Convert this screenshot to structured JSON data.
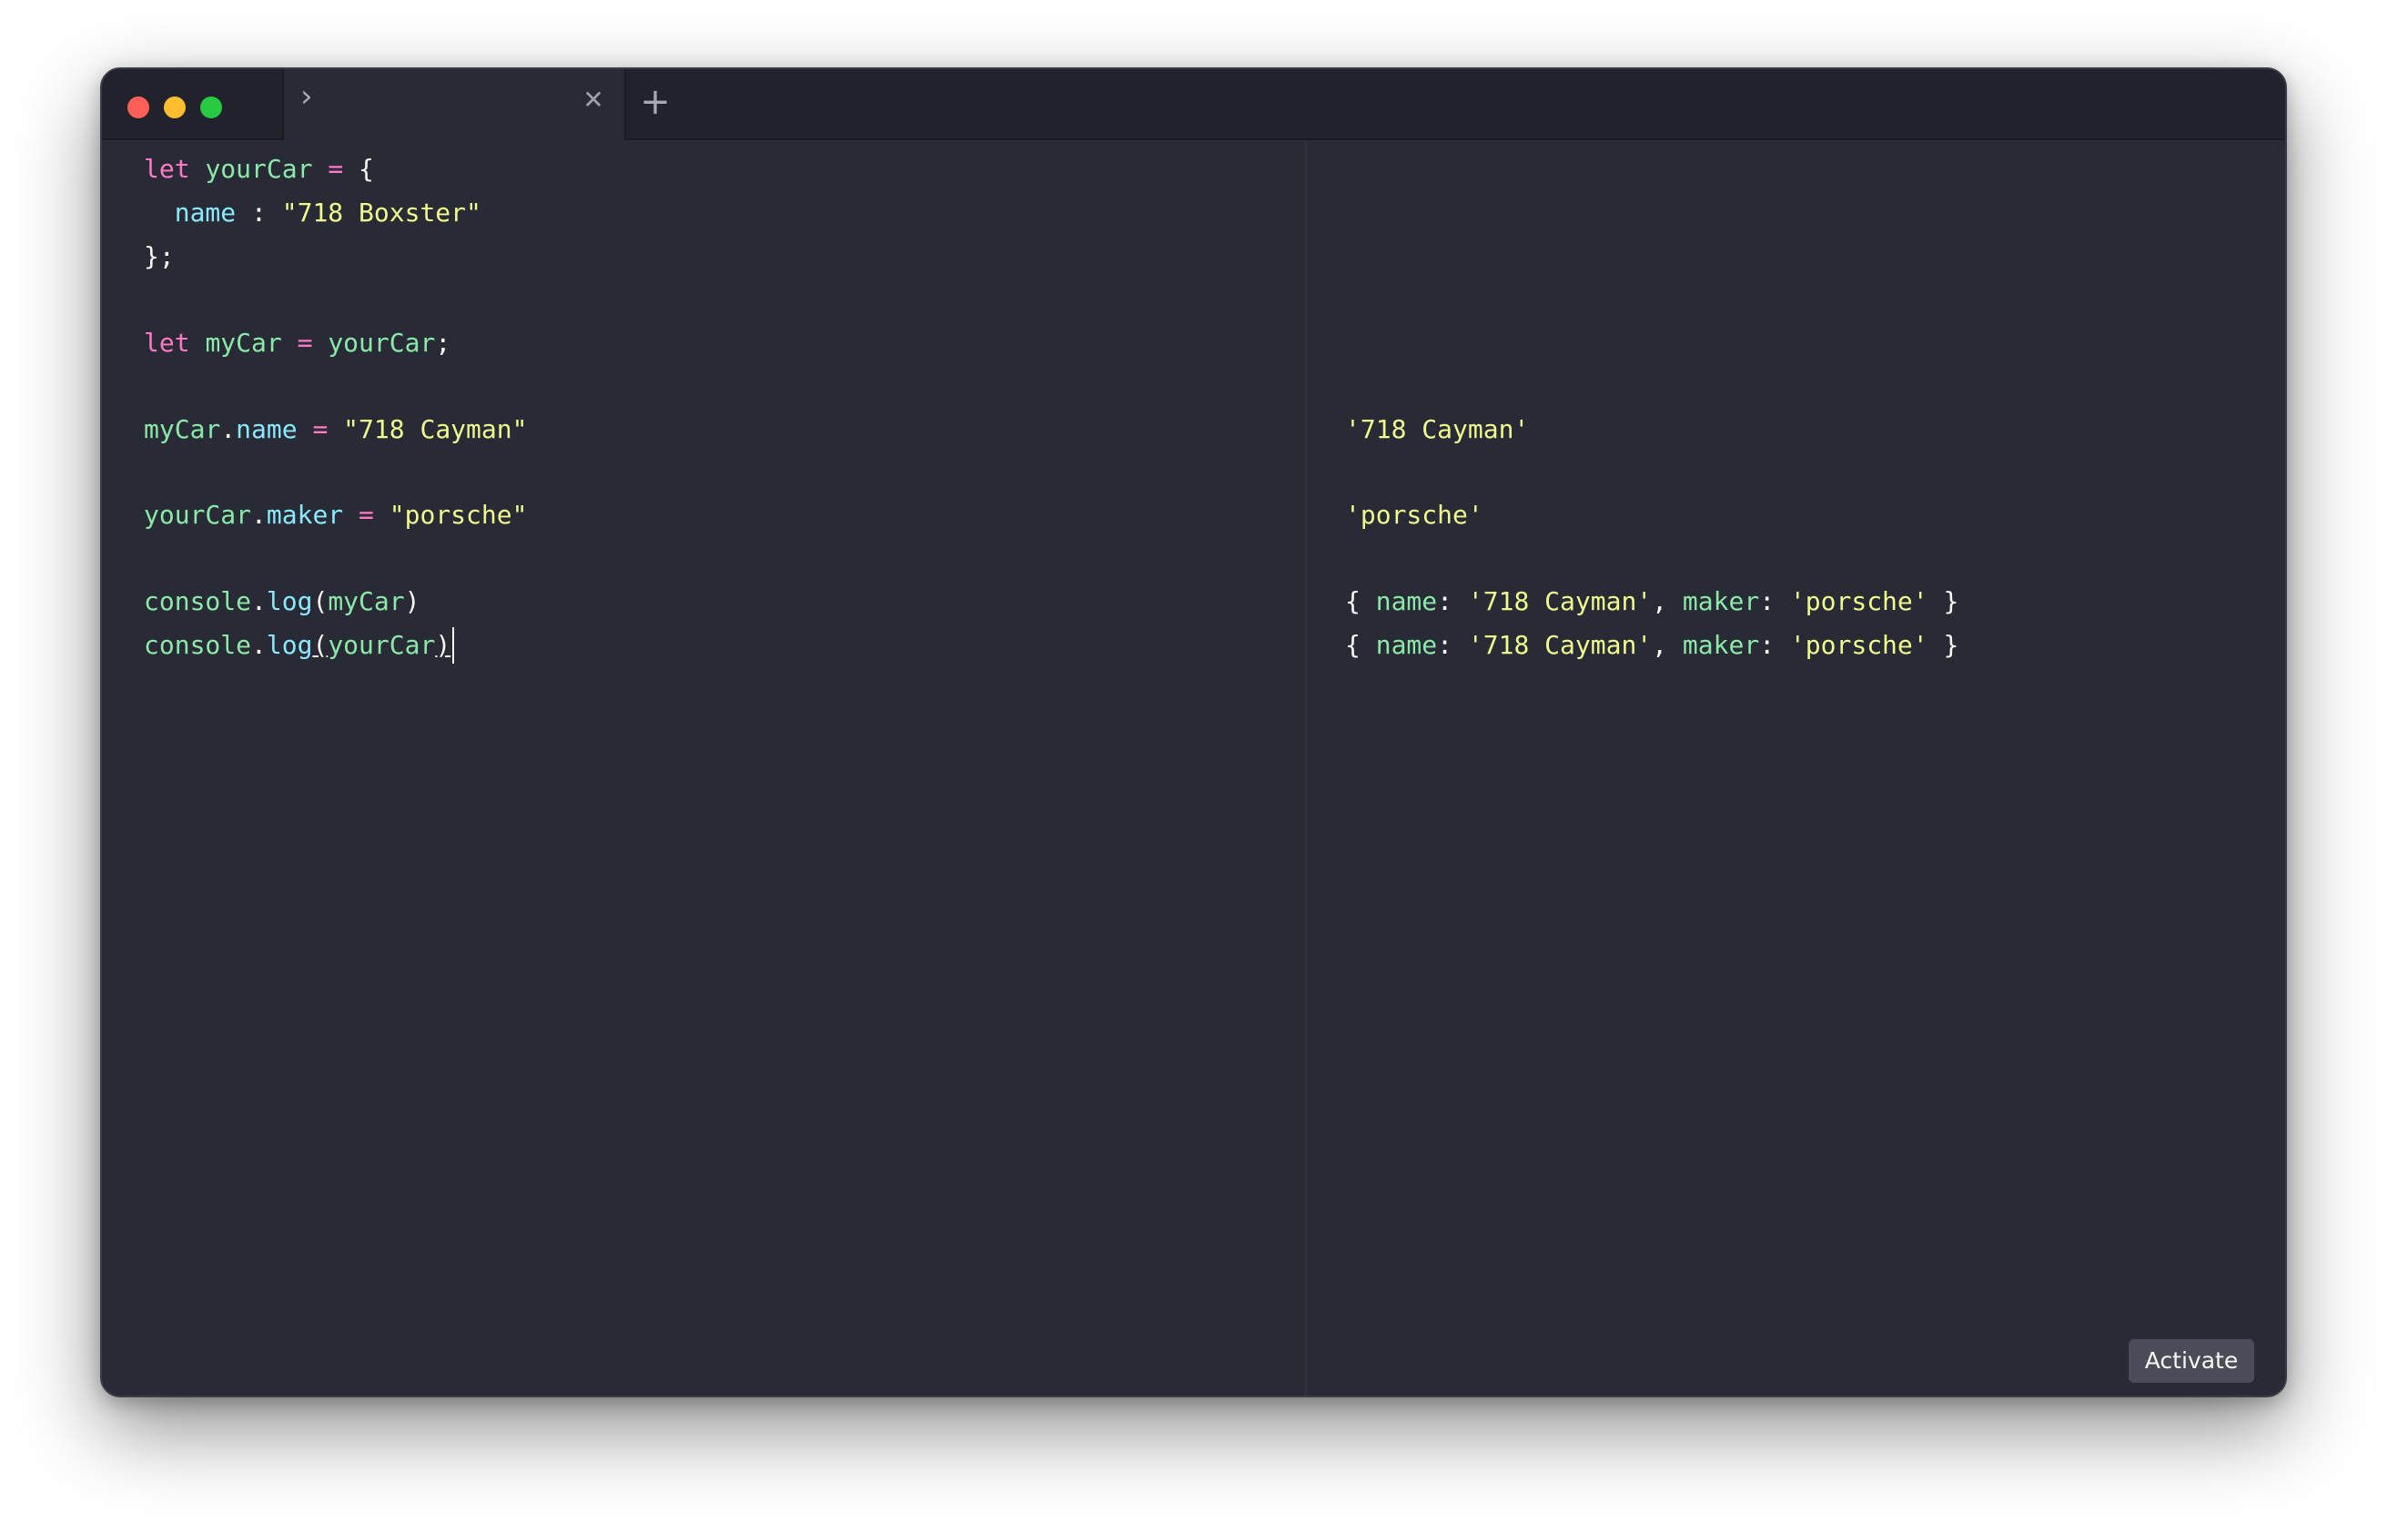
{
  "window": {
    "tab": {
      "prompt_icon": "chevron-right-icon",
      "close_icon": "close-icon"
    },
    "new_tab_icon": "plus-icon"
  },
  "colors": {
    "background": "#282a36",
    "titlebar": "#21222c",
    "keyword": "#ff79c6",
    "identifier": "#8be9a8",
    "property": "#8be9fd",
    "string": "#f1fa8c",
    "text": "#f8f8f2"
  },
  "editor": {
    "lines": [
      {
        "tokens": [
          {
            "t": "let",
            "c": "kw"
          },
          {
            "t": " ",
            "c": "punc"
          },
          {
            "t": "yourCar",
            "c": "var"
          },
          {
            "t": " ",
            "c": "punc"
          },
          {
            "t": "=",
            "c": "kw"
          },
          {
            "t": " {",
            "c": "punc"
          }
        ]
      },
      {
        "tokens": [
          {
            "t": "  ",
            "c": "punc"
          },
          {
            "t": "name",
            "c": "prop"
          },
          {
            "t": " : ",
            "c": "punc"
          },
          {
            "t": "\"718 Boxster\"",
            "c": "str"
          }
        ]
      },
      {
        "tokens": [
          {
            "t": "};",
            "c": "punc"
          }
        ]
      },
      {
        "tokens": [
          {
            "t": "let",
            "c": "kw"
          },
          {
            "t": " ",
            "c": "punc"
          },
          {
            "t": "myCar",
            "c": "var"
          },
          {
            "t": " ",
            "c": "punc"
          },
          {
            "t": "=",
            "c": "kw"
          },
          {
            "t": " ",
            "c": "punc"
          },
          {
            "t": "yourCar",
            "c": "var"
          },
          {
            "t": ";",
            "c": "punc"
          }
        ]
      },
      {
        "tokens": [
          {
            "t": "myCar",
            "c": "var"
          },
          {
            "t": ".",
            "c": "punc"
          },
          {
            "t": "name",
            "c": "prop"
          },
          {
            "t": " ",
            "c": "punc"
          },
          {
            "t": "=",
            "c": "kw"
          },
          {
            "t": " ",
            "c": "punc"
          },
          {
            "t": "\"718 Cayman\"",
            "c": "str"
          }
        ]
      },
      {
        "tokens": [
          {
            "t": "yourCar",
            "c": "var"
          },
          {
            "t": ".",
            "c": "punc"
          },
          {
            "t": "maker",
            "c": "prop"
          },
          {
            "t": " ",
            "c": "punc"
          },
          {
            "t": "=",
            "c": "kw"
          },
          {
            "t": " ",
            "c": "punc"
          },
          {
            "t": "\"porsche\"",
            "c": "str"
          }
        ]
      },
      {
        "tokens": [
          {
            "t": "console",
            "c": "var"
          },
          {
            "t": ".",
            "c": "punc"
          },
          {
            "t": "log",
            "c": "prop"
          },
          {
            "t": "(",
            "c": "punc"
          },
          {
            "t": "myCar",
            "c": "var"
          },
          {
            "t": ")",
            "c": "punc"
          }
        ]
      },
      {
        "tokens": [
          {
            "t": "console",
            "c": "var"
          },
          {
            "t": ".",
            "c": "punc"
          },
          {
            "t": "log",
            "c": "prop"
          },
          {
            "t": "(",
            "c": "punc",
            "u": true
          },
          {
            "t": "yourCar",
            "c": "var"
          },
          {
            "t": ")",
            "c": "punc",
            "u": true
          }
        ],
        "cursor": true
      }
    ]
  },
  "output": {
    "lines": [
      {
        "tokens": [
          {
            "t": "'718 Cayman'",
            "c": "str"
          }
        ]
      },
      {
        "tokens": [
          {
            "t": "'porsche'",
            "c": "str"
          }
        ]
      },
      {
        "tokens": [
          {
            "t": "{ ",
            "c": "punc"
          },
          {
            "t": "name",
            "c": "var"
          },
          {
            "t": ": ",
            "c": "punc"
          },
          {
            "t": "'718 Cayman'",
            "c": "str"
          },
          {
            "t": ", ",
            "c": "punc"
          },
          {
            "t": "maker",
            "c": "var"
          },
          {
            "t": ": ",
            "c": "punc"
          },
          {
            "t": "'porsche'",
            "c": "str"
          },
          {
            "t": " }",
            "c": "punc"
          }
        ]
      },
      {
        "tokens": [
          {
            "t": "{ ",
            "c": "punc"
          },
          {
            "t": "name",
            "c": "var"
          },
          {
            "t": ": ",
            "c": "punc"
          },
          {
            "t": "'718 Cayman'",
            "c": "str"
          },
          {
            "t": ", ",
            "c": "punc"
          },
          {
            "t": "maker",
            "c": "var"
          },
          {
            "t": ": ",
            "c": "punc"
          },
          {
            "t": "'porsche'",
            "c": "str"
          },
          {
            "t": " }",
            "c": "punc"
          }
        ]
      }
    ]
  },
  "activate_button": {
    "label": "Activate"
  }
}
